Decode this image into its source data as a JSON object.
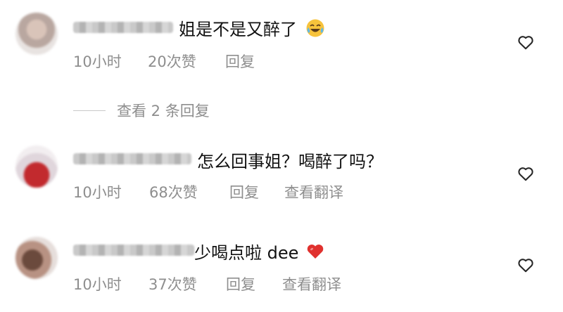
{
  "comments": [
    {
      "text": "姐是不是又醉了",
      "time": "10小时",
      "likes": "20次赞",
      "reply_label": "回复",
      "translate_label": "",
      "emoji": "laughing-tears-icon"
    },
    {
      "text": "怎么回事姐？喝醉了吗？",
      "time": "10小时",
      "likes": "68次赞",
      "reply_label": "回复",
      "translate_label": "查看翻译",
      "emoji": ""
    },
    {
      "text": "少喝点啦 dee",
      "time": "10小时",
      "likes": "37次赞",
      "reply_label": "回复",
      "translate_label": "查看翻译",
      "emoji": "red-heart-icon"
    }
  ],
  "view_replies": "查看 2 条回复",
  "colors": {
    "text": "#111111",
    "meta": "#8e8e8e",
    "heart_stroke": "#262626",
    "red_heart": "#e0312e",
    "emoji_yellow": "#f7c33c"
  }
}
